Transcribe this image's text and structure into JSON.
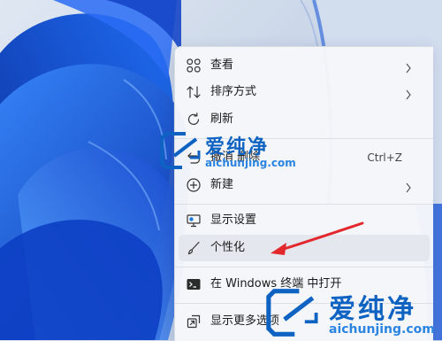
{
  "context_menu": {
    "items": [
      {
        "label": "查看",
        "icon": "grid-view-icon",
        "submenu": true
      },
      {
        "label": "排序方式",
        "icon": "sort-icon",
        "submenu": true
      },
      {
        "label": "刷新",
        "icon": "refresh-icon"
      },
      {
        "label": "撤消 删除",
        "icon": "undo-icon",
        "shortcut": "Ctrl+Z"
      },
      {
        "label": "新建",
        "icon": "new-plus-icon",
        "submenu": true
      },
      {
        "label": "显示设置",
        "icon": "display-settings-icon"
      },
      {
        "label": "个性化",
        "icon": "personalize-brush-icon",
        "highlighted": true
      },
      {
        "label": "在 Windows 终端 中打开",
        "icon": "terminal-icon"
      },
      {
        "label": "显示更多选项",
        "icon": "more-options-icon"
      }
    ]
  },
  "watermark": {
    "brand": "爱纯净",
    "url": "aichunjing.com"
  },
  "annotation": {
    "color": "#e2282d"
  },
  "colors": {
    "accent": "#0e63c2",
    "wallpaper": "#1a56d6"
  }
}
